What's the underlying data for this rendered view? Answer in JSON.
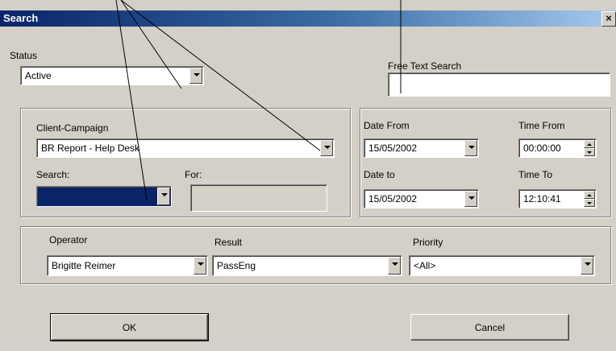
{
  "window": {
    "title": "Search",
    "close_glyph": "×"
  },
  "status": {
    "label": "Status",
    "value": "Active"
  },
  "free_text": {
    "label": "Free Text Search",
    "value": ""
  },
  "client_campaign": {
    "label": "Client-Campaign",
    "value": "BR Report - Help Desk",
    "search_label": "Search:",
    "search_value": "",
    "for_label": "For:",
    "for_value": ""
  },
  "dates": {
    "date_from_label": "Date From",
    "date_from": "15/05/2002",
    "date_to_label": "Date to",
    "date_to": "15/05/2002",
    "time_from_label": "Time From",
    "time_from": "00:00:00",
    "time_to_label": "Time To",
    "time_to": "12:10:41"
  },
  "filters": {
    "operator_label": "Operator",
    "operator_value": "Brigitte Reimer",
    "result_label": "Result",
    "result_value": "PassEng",
    "priority_label": "Priority",
    "priority_value": "<All>"
  },
  "buttons": {
    "ok": "OK",
    "cancel": "Cancel"
  },
  "colors": {
    "dialog_bg": "#d4d0c8",
    "title_start": "#0a246a",
    "title_end": "#a6caf0",
    "selection": "#0a246a"
  }
}
